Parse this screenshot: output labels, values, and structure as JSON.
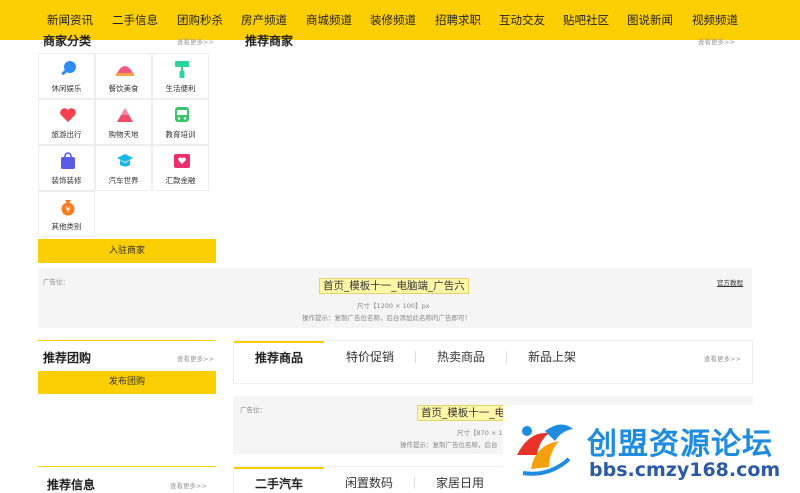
{
  "nav": {
    "items": [
      "新闻资讯",
      "二手信息",
      "团购秒杀",
      "房产频道",
      "商城频道",
      "装修频道",
      "招聘求职",
      "互动交友",
      "贴吧社区",
      "图说新闻",
      "视频频道"
    ]
  },
  "merchant_categories": {
    "title": "商家分类",
    "more": "查看更多>>",
    "items": [
      {
        "label": "休闲娱乐",
        "icon": "microphone-icon",
        "color": "#2f8cf0"
      },
      {
        "label": "餐饮美食",
        "icon": "dish-icon",
        "color": "#f05a7e"
      },
      {
        "label": "生活便利",
        "icon": "paint-roller-icon",
        "color": "#2ed39a"
      },
      {
        "label": "旅游出行",
        "icon": "heart-icon",
        "color": "#f5414f"
      },
      {
        "label": "购物天地",
        "icon": "mountain-icon",
        "color": "#f04b6d"
      },
      {
        "label": "教育培训",
        "icon": "bus-icon",
        "color": "#3cc46b"
      },
      {
        "label": "装饰装修",
        "icon": "bag-icon",
        "color": "#5b5ce6"
      },
      {
        "label": "汽车世界",
        "icon": "graduation-cap-icon",
        "color": "#16b6e8"
      },
      {
        "label": "汇款金融",
        "icon": "card-icon",
        "color": "#ea2f6b"
      },
      {
        "label": "其他类别",
        "icon": "money-bag-icon",
        "color": "#f57c1f"
      }
    ],
    "join_button": "入驻商家"
  },
  "recommended_merchants": {
    "title": "推荐商家",
    "more": "查看更多>>"
  },
  "ad_main": {
    "label": "广告位：",
    "help": "官方教程",
    "title": "首页_模板十一_电脑端_广告六",
    "size": "尺寸【1200 × 100】px",
    "tip": "操作提示：复制广告位名称，后台添加此名称的广告即可！"
  },
  "group_buy": {
    "title": "推荐团购",
    "more": "查看更多>>",
    "button": "发布团购"
  },
  "products": {
    "tabs": [
      "推荐商品",
      "特价促销",
      "热卖商品",
      "新品上架"
    ],
    "more": "查看更多>>"
  },
  "ad_secondary": {
    "label": "广告位：",
    "title": "首页_模板十一_电",
    "size": "尺寸【870 × 1",
    "tip": "操作提示：复制广告位名称，后台"
  },
  "info": {
    "title": "推荐信息",
    "more": "查看更多>>"
  },
  "info_tabs": {
    "tabs": [
      "二手汽车",
      "闲置数码",
      "家居日用"
    ]
  },
  "watermark": {
    "cn": "创盟资源论坛",
    "url": "bbs.cmzy168.com"
  }
}
